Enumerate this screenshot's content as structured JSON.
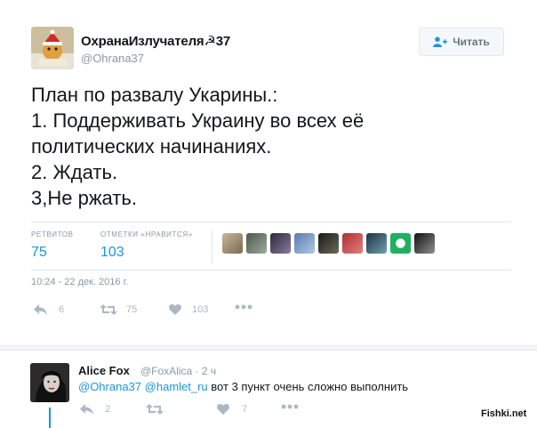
{
  "tweet": {
    "author_name": "ОхранаИзлучателя☭37",
    "author_handle": "@Ohrana37",
    "follow_label": "Читать",
    "text_lines": [
      "План по развалу Укарины.:",
      "1. Поддерживать Украину во всех её",
      "политических начинаниях.",
      "2. Ждать.",
      "3,Не ржать."
    ],
    "stats": {
      "retweets_label": "РЕТВИТОВ",
      "retweets_value": "75",
      "likes_label": "ОТМЕТКИ «НРАВИТСЯ»",
      "likes_value": "103"
    },
    "timestamp": "10:24 - 22 дек. 2016 г.",
    "actions": {
      "reply_count": "6",
      "retweet_count": "75",
      "like_count": "103"
    }
  },
  "reply": {
    "author_name": "Alice Fox",
    "author_handle_time": "@FoxAlica · 2 ч",
    "mention_1": "@Ohrana37",
    "mention_2": "@hamlet_ru",
    "text": "вот 3 пункт очень сложно выполнить",
    "actions": {
      "reply_count": "2",
      "like_count": "7"
    }
  },
  "watermark": "Fishki.net",
  "colors": {
    "link_blue": "#1b95e0",
    "muted_gray": "#8899a6",
    "action_gray": "#aab8c2"
  }
}
